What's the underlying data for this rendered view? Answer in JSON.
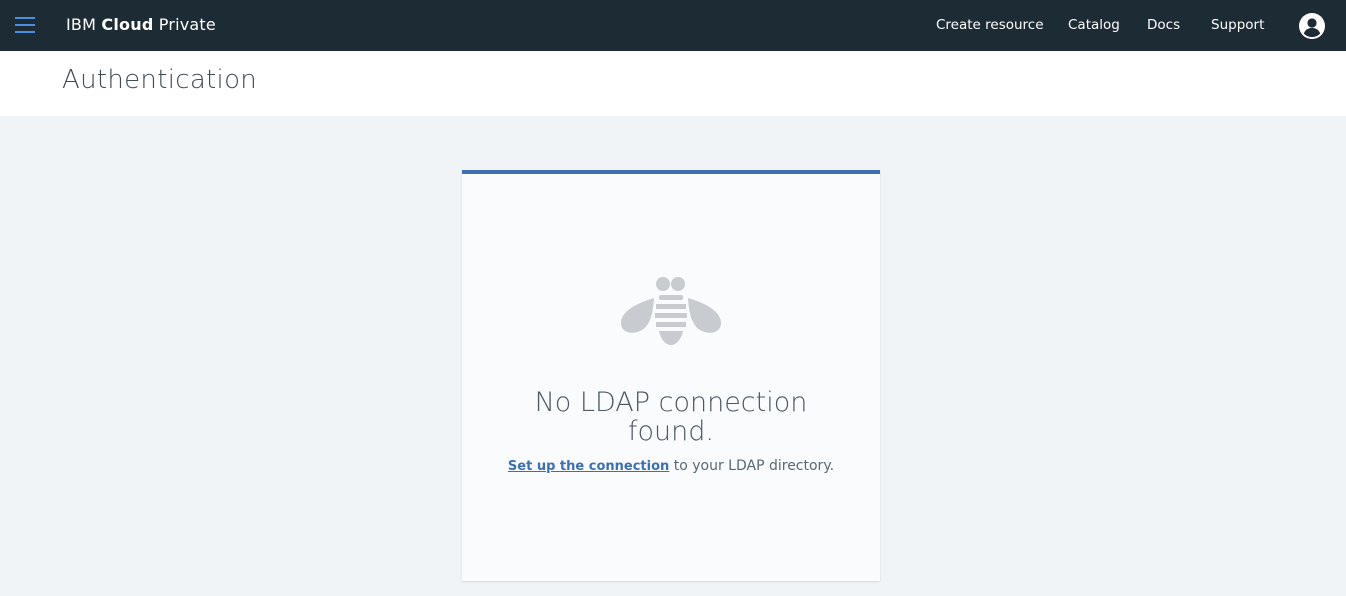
{
  "header": {
    "brand_prefix": "IBM",
    "brand_bold": "Cloud",
    "brand_suffix": "Private",
    "nav": {
      "create": "Create resource",
      "catalog": "Catalog",
      "docs": "Docs",
      "support": "Support"
    },
    "bg_color": "#1d2b35",
    "menu_icon": "hamburger-menu-icon",
    "user_icon": "user-avatar-icon"
  },
  "page": {
    "title": "Authentication"
  },
  "empty_state": {
    "icon": "bee-icon",
    "title": "No LDAP connection found.",
    "link_text": "Set up the connection",
    "desc_suffix": " to your LDAP directory.",
    "accent_color": "#3d70b2"
  }
}
